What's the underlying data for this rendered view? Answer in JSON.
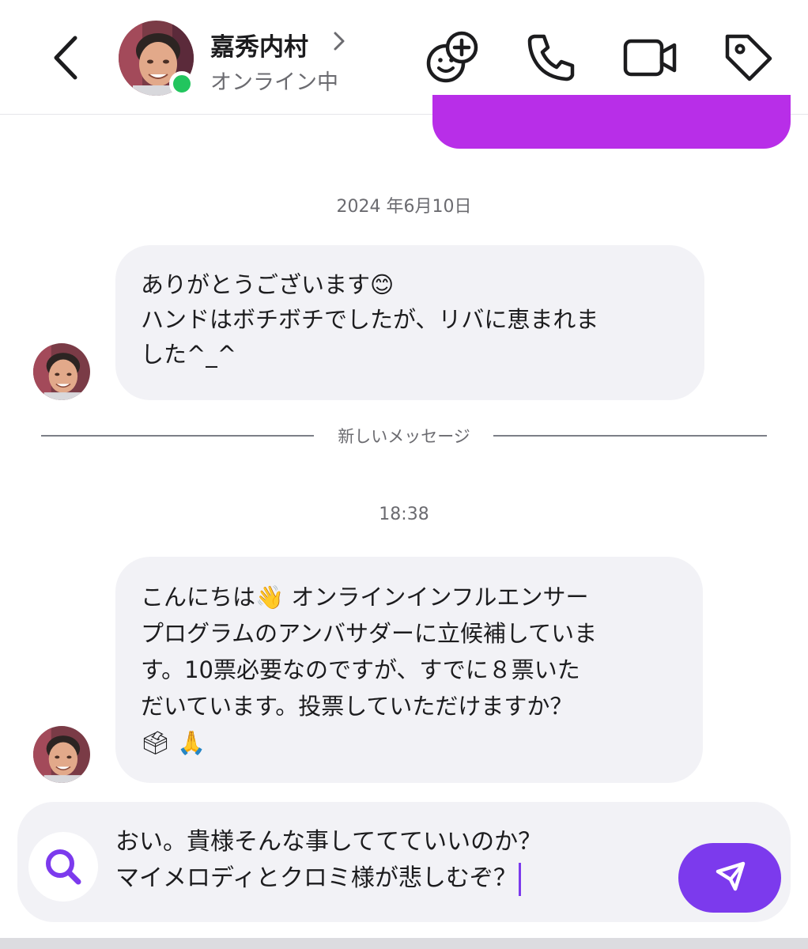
{
  "header": {
    "contact_name": "嘉秀内村",
    "status": "オンライン中"
  },
  "messages": {
    "date_separator": "2024 年6月10日",
    "message_1": {
      "lines": [
        "ありがとうございます😊",
        "ハンドはボチボチでしたが、リバに恵まれま",
        "した^_^"
      ]
    },
    "new_messages_label": "新しいメッセージ",
    "time_separator": "18:38",
    "message_2": {
      "lines": [
        "こんにちは👋 オンラインインフルエンサー",
        "プログラムのアンバサダーに立候補していま",
        "す。10票必要なのですが、すでに８票いた",
        "だいています。投票していただけますか？",
        "🗳 🙏"
      ]
    }
  },
  "composer": {
    "lines": [
      "おい。貴様そんな事しててていいのか？",
      "マイメロディとクロミ様が悲しむぞ？"
    ]
  },
  "colors": {
    "accent": "#7c3aed",
    "sent_bubble": "#b82ee8",
    "received_bubble": "#f2f2f6",
    "online": "#22c55e"
  },
  "icons": [
    "chevron-left-icon",
    "chevron-right-icon",
    "add-emoji-icon",
    "phone-icon",
    "video-icon",
    "tag-icon",
    "search-icon",
    "send-icon"
  ]
}
